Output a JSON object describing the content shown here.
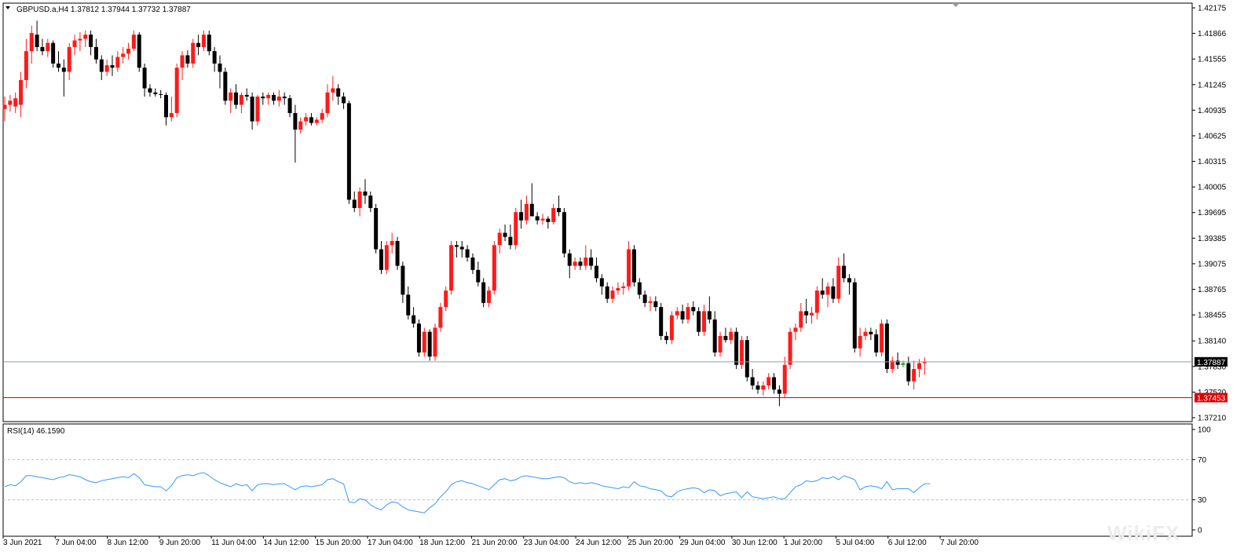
{
  "header": {
    "symbol_line": "GBPUSD.a,H4  1.37812 1.37944 1.37732 1.37887",
    "rsi_label": "RSI(14) 46.1590"
  },
  "watermark": "WikiFX",
  "colors": {
    "bull": "#ff1a1a",
    "bear": "#000000",
    "doji": "#00b000",
    "rsi_line": "#3399ff",
    "bid_line": "#8a9fb5",
    "bid_tag": "#000000",
    "level_line": "#e00000",
    "level_tag": "#e00000",
    "grid_dash": "#bdbdbd"
  },
  "chart_data": [
    {
      "type": "candlestick",
      "symbol": "GBPUSD.a",
      "timeframe": "H4",
      "ylim": [
        1.3721,
        1.42175
      ],
      "y_ticks": [
        "1.42175",
        "1.41866",
        "1.41555",
        "1.41245",
        "1.40935",
        "1.40625",
        "1.40315",
        "1.40005",
        "1.39695",
        "1.39385",
        "1.39075",
        "1.38765",
        "1.38455",
        "1.38140",
        "1.37830",
        "1.37520",
        "1.37210"
      ],
      "x_ticks": [
        "3 Jun 2021",
        "7 Jun 04:00",
        "8 Jun 12:00",
        "9 Jun 20:00",
        "11 Jun 04:00",
        "14 Jun 12:00",
        "15 Jun 20:00",
        "17 Jun 04:00",
        "18 Jun 12:00",
        "21 Jun 20:00",
        "23 Jun 04:00",
        "24 Jun 12:00",
        "25 Jun 20:00",
        "29 Jun 04:00",
        "30 Jun 12:00",
        "1 Jul 20:00",
        "5 Jul 04:00",
        "6 Jul 12:00",
        "7 Jul 20:00"
      ],
      "bid_price": "1.37887",
      "level_price": "1.37453",
      "candles_ohlc": [
        [
          1.4095,
          1.411,
          1.408,
          1.41
        ],
        [
          1.41,
          1.4112,
          1.4092,
          1.4105
        ],
        [
          1.4098,
          1.4115,
          1.409,
          1.4108
        ],
        [
          1.41,
          1.414,
          1.4085,
          1.413
        ],
        [
          1.413,
          1.418,
          1.412,
          1.4165
        ],
        [
          1.4165,
          1.4196,
          1.415,
          1.4187
        ],
        [
          1.4185,
          1.4202,
          1.4165,
          1.417
        ],
        [
          1.417,
          1.418,
          1.416,
          1.4165
        ],
        [
          1.4165,
          1.418,
          1.4158,
          1.4175
        ],
        [
          1.4175,
          1.4178,
          1.4145,
          1.415
        ],
        [
          1.415,
          1.4165,
          1.414,
          1.4145
        ],
        [
          1.4145,
          1.4155,
          1.411,
          1.414
        ],
        [
          1.414,
          1.4175,
          1.413,
          1.417
        ],
        [
          1.417,
          1.4185,
          1.416,
          1.4178
        ],
        [
          1.4178,
          1.4188,
          1.4165,
          1.418
        ],
        [
          1.418,
          1.419,
          1.417,
          1.4185
        ],
        [
          1.4185,
          1.419,
          1.416,
          1.417
        ],
        [
          1.417,
          1.418,
          1.415,
          1.4155
        ],
        [
          1.4155,
          1.416,
          1.413,
          1.414
        ],
        [
          1.414,
          1.4155,
          1.4135,
          1.4148
        ],
        [
          1.4148,
          1.416,
          1.4135,
          1.4145
        ],
        [
          1.4145,
          1.4165,
          1.414,
          1.4158
        ],
        [
          1.4158,
          1.417,
          1.415,
          1.4162
        ],
        [
          1.4162,
          1.4175,
          1.4155,
          1.4168
        ],
        [
          1.4168,
          1.419,
          1.4165,
          1.4185
        ],
        [
          1.4185,
          1.4188,
          1.414,
          1.4145
        ],
        [
          1.4145,
          1.415,
          1.411,
          1.412
        ],
        [
          1.412,
          1.4125,
          1.411,
          1.4115
        ],
        [
          1.4115,
          1.412,
          1.411,
          1.4113
        ],
        [
          1.4113,
          1.4118,
          1.4108,
          1.4112
        ],
        [
          1.4112,
          1.4115,
          1.4075,
          1.4085
        ],
        [
          1.4085,
          1.411,
          1.408,
          1.409
        ],
        [
          1.409,
          1.415,
          1.4085,
          1.4145
        ],
        [
          1.4145,
          1.4165,
          1.413,
          1.416
        ],
        [
          1.416,
          1.4166,
          1.4145,
          1.415
        ],
        [
          1.415,
          1.418,
          1.4145,
          1.4175
        ],
        [
          1.4175,
          1.4185,
          1.416,
          1.417
        ],
        [
          1.417,
          1.419,
          1.4165,
          1.4185
        ],
        [
          1.4185,
          1.419,
          1.416,
          1.4165
        ],
        [
          1.4165,
          1.417,
          1.414,
          1.415
        ],
        [
          1.415,
          1.416,
          1.412,
          1.414
        ],
        [
          1.414,
          1.4145,
          1.41,
          1.4105
        ],
        [
          1.4105,
          1.412,
          1.409,
          1.4115
        ],
        [
          1.4115,
          1.4125,
          1.4095,
          1.41
        ],
        [
          1.41,
          1.4115,
          1.409,
          1.4112
        ],
        [
          1.4112,
          1.412,
          1.4105,
          1.411
        ],
        [
          1.411,
          1.4115,
          1.407,
          1.408
        ],
        [
          1.408,
          1.4112,
          1.4075,
          1.411
        ],
        [
          1.411,
          1.4115,
          1.41,
          1.4108
        ],
        [
          1.4108,
          1.4115,
          1.41,
          1.4112
        ],
        [
          1.4112,
          1.4115,
          1.41,
          1.4105
        ],
        [
          1.4105,
          1.4118,
          1.4098,
          1.411
        ],
        [
          1.411,
          1.4115,
          1.41,
          1.4108
        ],
        [
          1.4108,
          1.4112,
          1.4085,
          1.409
        ],
        [
          1.409,
          1.41,
          1.403,
          1.407
        ],
        [
          1.407,
          1.4085,
          1.4065,
          1.408
        ],
        [
          1.408,
          1.409,
          1.4075,
          1.4085
        ],
        [
          1.4085,
          1.409,
          1.4075,
          1.4078
        ],
        [
          1.4078,
          1.4085,
          1.4075,
          1.4082
        ],
        [
          1.4082,
          1.4095,
          1.4078,
          1.409
        ],
        [
          1.409,
          1.4125,
          1.4085,
          1.4115
        ],
        [
          1.4115,
          1.4135,
          1.4105,
          1.412
        ],
        [
          1.412,
          1.4125,
          1.41,
          1.411
        ],
        [
          1.411,
          1.4115,
          1.4095,
          1.4102
        ],
        [
          1.4102,
          1.4105,
          1.398,
          1.3985
        ],
        [
          1.3985,
          1.3995,
          1.397,
          1.3975
        ],
        [
          1.3975,
          1.4,
          1.3965,
          1.3995
        ],
        [
          1.3995,
          1.401,
          1.398,
          1.399
        ],
        [
          1.399,
          1.3995,
          1.397,
          1.3975
        ],
        [
          1.3975,
          1.398,
          1.392,
          1.3925
        ],
        [
          1.3925,
          1.3935,
          1.3895,
          1.39
        ],
        [
          1.39,
          1.3935,
          1.3895,
          1.393
        ],
        [
          1.393,
          1.3945,
          1.392,
          1.3935
        ],
        [
          1.3935,
          1.394,
          1.39,
          1.3905
        ],
        [
          1.3905,
          1.391,
          1.386,
          1.387
        ],
        [
          1.387,
          1.388,
          1.384,
          1.3845
        ],
        [
          1.3845,
          1.3855,
          1.383,
          1.3835
        ],
        [
          1.3835,
          1.384,
          1.3795,
          1.38
        ],
        [
          1.38,
          1.383,
          1.3795,
          1.3825
        ],
        [
          1.3825,
          1.3828,
          1.379,
          1.3795
        ],
        [
          1.3795,
          1.3835,
          1.379,
          1.383
        ],
        [
          1.383,
          1.386,
          1.3825,
          1.3855
        ],
        [
          1.3855,
          1.388,
          1.385,
          1.3875
        ],
        [
          1.3875,
          1.3935,
          1.387,
          1.393
        ],
        [
          1.393,
          1.3935,
          1.3915,
          1.3928
        ],
        [
          1.3928,
          1.3935,
          1.3915,
          1.3925
        ],
        [
          1.3925,
          1.393,
          1.391,
          1.3915
        ],
        [
          1.3915,
          1.392,
          1.3895,
          1.39
        ],
        [
          1.39,
          1.391,
          1.388,
          1.3885
        ],
        [
          1.3885,
          1.389,
          1.3855,
          1.386
        ],
        [
          1.386,
          1.388,
          1.3855,
          1.3875
        ],
        [
          1.3875,
          1.3935,
          1.387,
          1.393
        ],
        [
          1.393,
          1.395,
          1.392,
          1.3945
        ],
        [
          1.3945,
          1.3955,
          1.3935,
          1.394
        ],
        [
          1.394,
          1.3955,
          1.3925,
          1.393
        ],
        [
          1.393,
          1.3975,
          1.3925,
          1.397
        ],
        [
          1.397,
          1.3985,
          1.395,
          1.396
        ],
        [
          1.396,
          1.399,
          1.3955,
          1.398
        ],
        [
          1.398,
          1.4005,
          1.397,
          1.3965
        ],
        [
          1.3965,
          1.397,
          1.3955,
          1.396
        ],
        [
          1.396,
          1.3968,
          1.3955,
          1.3962
        ],
        [
          1.3962,
          1.3965,
          1.395,
          1.3958
        ],
        [
          1.3958,
          1.398,
          1.3955,
          1.3975
        ],
        [
          1.3975,
          1.399,
          1.3965,
          1.397
        ],
        [
          1.397,
          1.3975,
          1.3915,
          1.392
        ],
        [
          1.392,
          1.3925,
          1.389,
          1.3905
        ],
        [
          1.3905,
          1.3915,
          1.39,
          1.391
        ],
        [
          1.391,
          1.3915,
          1.39,
          1.3905
        ],
        [
          1.3905,
          1.393,
          1.39,
          1.3915
        ],
        [
          1.3915,
          1.3925,
          1.39,
          1.3905
        ],
        [
          1.3905,
          1.3915,
          1.3885,
          1.389
        ],
        [
          1.389,
          1.3895,
          1.387,
          1.388
        ],
        [
          1.388,
          1.3885,
          1.386,
          1.3865
        ],
        [
          1.3865,
          1.388,
          1.386,
          1.3875
        ],
        [
          1.3875,
          1.3885,
          1.387,
          1.3878
        ],
        [
          1.3878,
          1.3885,
          1.387,
          1.388
        ],
        [
          1.388,
          1.3935,
          1.3875,
          1.3925
        ],
        [
          1.3925,
          1.393,
          1.388,
          1.3885
        ],
        [
          1.3885,
          1.389,
          1.3865,
          1.387
        ],
        [
          1.387,
          1.3875,
          1.3855,
          1.386
        ],
        [
          1.386,
          1.3868,
          1.385,
          1.3862
        ],
        [
          1.3862,
          1.3868,
          1.385,
          1.3855
        ],
        [
          1.3855,
          1.386,
          1.3815,
          1.382
        ],
        [
          1.382,
          1.3825,
          1.381,
          1.3815
        ],
        [
          1.3815,
          1.385,
          1.381,
          1.3845
        ],
        [
          1.3845,
          1.3855,
          1.384,
          1.385
        ],
        [
          1.385,
          1.3858,
          1.3835,
          1.384
        ],
        [
          1.384,
          1.386,
          1.3835,
          1.3855
        ],
        [
          1.3855,
          1.3862,
          1.3845,
          1.385
        ],
        [
          1.385,
          1.3855,
          1.382,
          1.3825
        ],
        [
          1.3825,
          1.3858,
          1.382,
          1.385
        ],
        [
          1.385,
          1.3868,
          1.3835,
          1.384
        ],
        [
          1.384,
          1.385,
          1.3795,
          1.38
        ],
        [
          1.38,
          1.3825,
          1.3795,
          1.382
        ],
        [
          1.382,
          1.383,
          1.3812,
          1.3815
        ],
        [
          1.3815,
          1.383,
          1.381,
          1.3825
        ],
        [
          1.3825,
          1.383,
          1.378,
          1.3785
        ],
        [
          1.3785,
          1.382,
          1.378,
          1.3815
        ],
        [
          1.3815,
          1.382,
          1.3765,
          1.377
        ],
        [
          1.377,
          1.378,
          1.3755,
          1.376
        ],
        [
          1.376,
          1.3765,
          1.375,
          1.3755
        ],
        [
          1.3755,
          1.3765,
          1.3748,
          1.376
        ],
        [
          1.376,
          1.3775,
          1.3755,
          1.377
        ],
        [
          1.377,
          1.3775,
          1.375,
          1.3755
        ],
        [
          1.3755,
          1.376,
          1.3735,
          1.375
        ],
        [
          1.375,
          1.3795,
          1.3745,
          1.3785
        ],
        [
          1.3785,
          1.383,
          1.378,
          1.3825
        ],
        [
          1.3825,
          1.3835,
          1.3815,
          1.383
        ],
        [
          1.383,
          1.386,
          1.3825,
          1.385
        ],
        [
          1.385,
          1.3865,
          1.3835,
          1.3845
        ],
        [
          1.3845,
          1.3855,
          1.3835,
          1.3848
        ],
        [
          1.3848,
          1.388,
          1.384,
          1.3875
        ],
        [
          1.3875,
          1.389,
          1.3865,
          1.387
        ],
        [
          1.387,
          1.3885,
          1.3855,
          1.388
        ],
        [
          1.388,
          1.389,
          1.386,
          1.3865
        ],
        [
          1.3865,
          1.3915,
          1.386,
          1.3905
        ],
        [
          1.3905,
          1.392,
          1.3885,
          1.389
        ],
        [
          1.389,
          1.3895,
          1.387,
          1.3885
        ],
        [
          1.3885,
          1.389,
          1.38,
          1.3805
        ],
        [
          1.3805,
          1.383,
          1.3795,
          1.382
        ],
        [
          1.382,
          1.383,
          1.3815,
          1.3825
        ],
        [
          1.3825,
          1.383,
          1.3815,
          1.3822
        ],
        [
          1.3822,
          1.3828,
          1.3795,
          1.38
        ],
        [
          1.38,
          1.384,
          1.3795,
          1.3835
        ],
        [
          1.3835,
          1.384,
          1.3775,
          1.378
        ],
        [
          1.378,
          1.3795,
          1.3775,
          1.379
        ],
        [
          1.379,
          1.38,
          1.378,
          1.3785
        ],
        [
          1.3785,
          1.379,
          1.3782,
          1.3787
        ],
        [
          1.3787,
          1.3795,
          1.376,
          1.3765
        ],
        [
          1.3765,
          1.379,
          1.3755,
          1.378
        ],
        [
          1.378,
          1.3792,
          1.377,
          1.3787
        ],
        [
          1.3787,
          1.3794,
          1.3773,
          1.3789
        ]
      ]
    },
    {
      "type": "line",
      "name": "RSI(14)",
      "ylim": [
        0,
        100
      ],
      "y_ticks": [
        "100",
        "70",
        "30",
        "0"
      ],
      "levels": [
        70,
        30
      ],
      "last_value": 46.159,
      "values": [
        43,
        45,
        44,
        48,
        54,
        54,
        53,
        52,
        51,
        50,
        52,
        53,
        55,
        54,
        53,
        50,
        48,
        47,
        49,
        50,
        51,
        52,
        53,
        52,
        56,
        52,
        45,
        44,
        43,
        43,
        39,
        44,
        52,
        54,
        55,
        54,
        56,
        57,
        54,
        50,
        47,
        45,
        43,
        46,
        44,
        45,
        39,
        45,
        46,
        46,
        45,
        46,
        46,
        43,
        40,
        43,
        44,
        43,
        44,
        45,
        50,
        51,
        48,
        46,
        28,
        27,
        31,
        30,
        25,
        22,
        20,
        25,
        28,
        27,
        23,
        20,
        19,
        18,
        17,
        22,
        26,
        33,
        38,
        45,
        48,
        49,
        47,
        46,
        44,
        42,
        40,
        45,
        50,
        51,
        49,
        50,
        53,
        54,
        53,
        52,
        51,
        51,
        52,
        53,
        52,
        48,
        46,
        47,
        46,
        47,
        46,
        44,
        43,
        42,
        41,
        43,
        42,
        48,
        44,
        43,
        41,
        40,
        39,
        34,
        33,
        38,
        40,
        41,
        42,
        41,
        37,
        40,
        39,
        34,
        36,
        37,
        38,
        32,
        38,
        33,
        32,
        31,
        32,
        33,
        31,
        31,
        37,
        43,
        45,
        49,
        48,
        49,
        52,
        51,
        53,
        50,
        54,
        52,
        50,
        40,
        43,
        44,
        43,
        41,
        48,
        40,
        41,
        41,
        41,
        37,
        42,
        46,
        46
      ]
    }
  ]
}
